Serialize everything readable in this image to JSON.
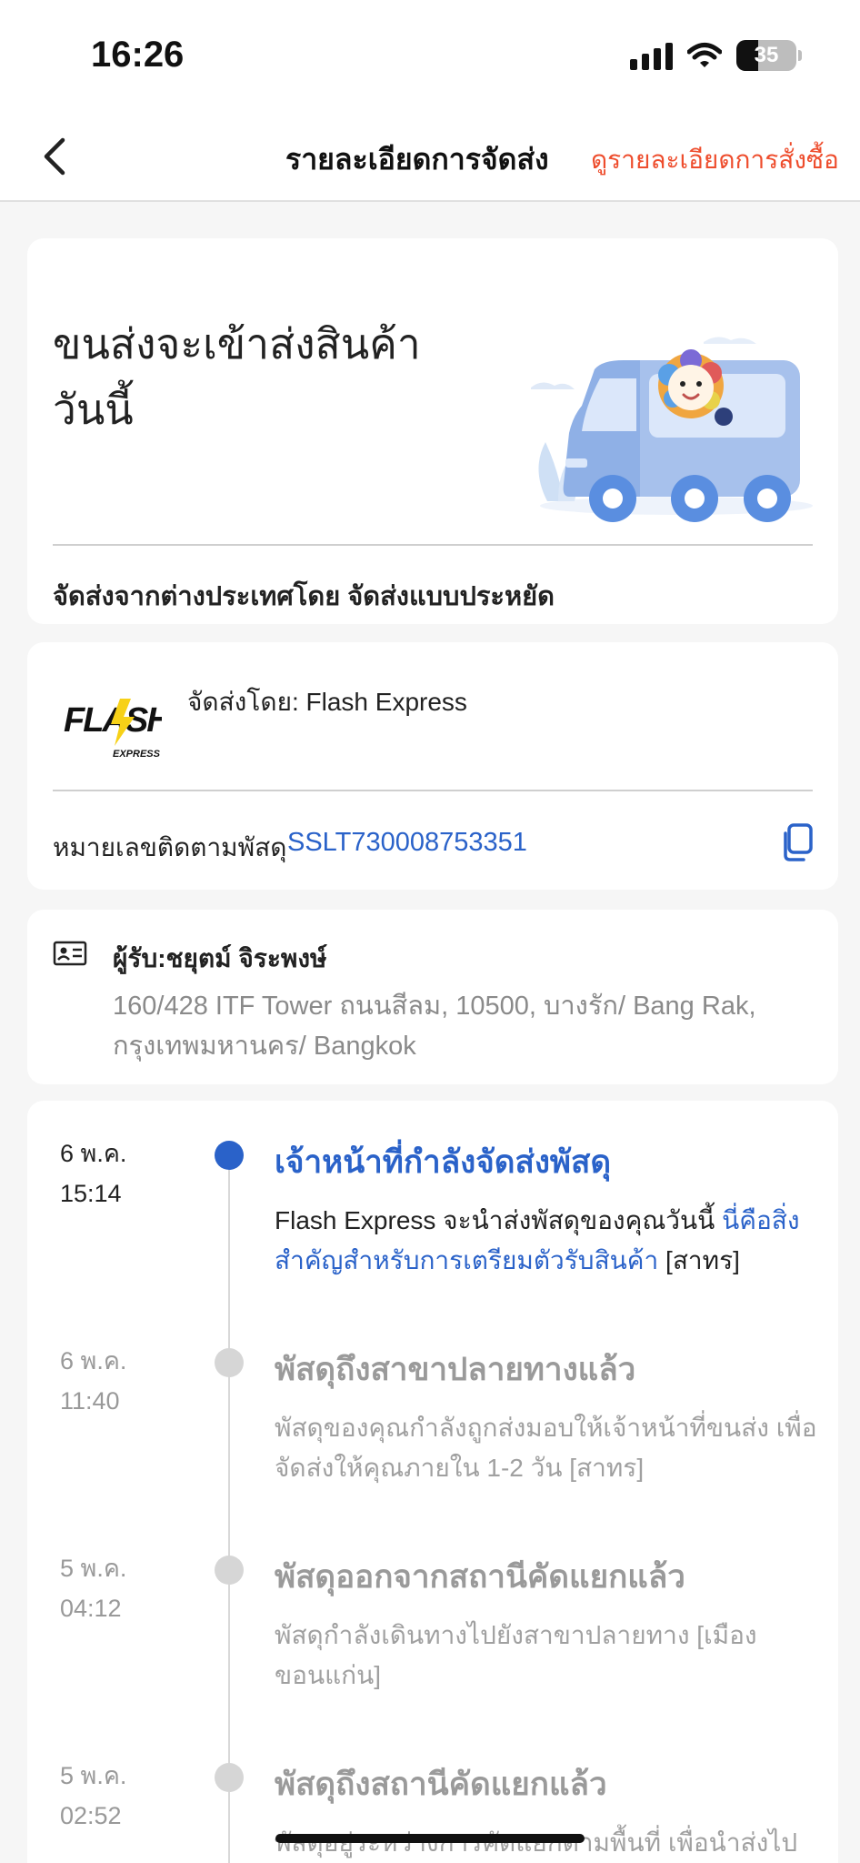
{
  "status_bar": {
    "time": "16:26",
    "battery": "35"
  },
  "header": {
    "title": "รายละเอียดการจัดส่ง",
    "order_link": "ดูรายละเอียดการสั่งซื้อ"
  },
  "hero": {
    "title_line1": "ขนส่งจะเข้าส่งสินค้า",
    "title_line2": "วันนี้",
    "subtitle": "จัดส่งจากต่างประเทศโดย จัดส่งแบบประหยัด"
  },
  "carrier": {
    "logo_text": "FLASH",
    "logo_subtext": "EXPRESS",
    "shipped_by": "จัดส่งโดย: Flash Express",
    "tracking_label": "หมายเลขติดตามพัสดุ",
    "tracking_number": "SSLT730008753351"
  },
  "recipient": {
    "name": "ผู้รับ:ชยุตม์ จิระพงษ์",
    "address": "160/428 ITF Tower ถนนสีลม, 10500, บางรัก/ Bang Rak, กรุงเทพมหานคร/ Bangkok"
  },
  "timeline": [
    {
      "date": "6 พ.ค.",
      "time": "15:14",
      "title": "เจ้าหน้าที่กำลังจัดส่งพัสดุ",
      "desc_before": "Flash Express จะนำส่งพัสดุของคุณวันนี้ ",
      "desc_link": "นี่คือสิ่งสำคัญสำหรับการเตรียมตัวรับสินค้า",
      "desc_after": " [สาทร]"
    },
    {
      "date": "6 พ.ค.",
      "time": "11:40",
      "title": "พัสดุถึงสาขาปลายทางแล้ว",
      "desc": "พัสดุของคุณกำลังถูกส่งมอบให้เจ้าหน้าที่ขนส่ง เพื่อจัดส่งให้คุณภายใน 1-2  วัน [สาทร]"
    },
    {
      "date": "5 พ.ค.",
      "time": "04:12",
      "title": "พัสดุออกจากสถานีคัดแยกแล้ว",
      "desc": "พัสดุกำลังเดินทางไปยังสาขาปลายทาง [เมืองขอนแก่น]"
    },
    {
      "date": "5 พ.ค.",
      "time": "02:52",
      "title": "พัสดุถึงสถานีคัดแยกแล้ว",
      "desc": "พัสดุอยู่ระหว่างการคัดแยกตามพื้นที่ เพื่อนำส่งไป"
    }
  ],
  "colors": {
    "accent_link": "#2a62c9",
    "header_link": "#ee4d2d",
    "inactive": "#9a9a9a"
  }
}
